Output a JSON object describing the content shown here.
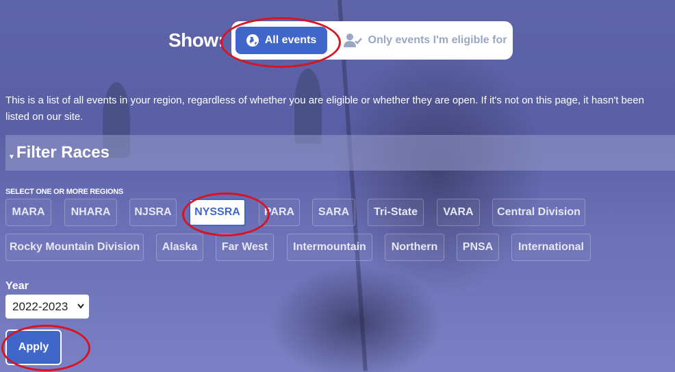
{
  "show": {
    "label": "Show:",
    "options": [
      {
        "label": "All events",
        "icon": "globe-icon",
        "active": true
      },
      {
        "label": "Only events I'm eligible for",
        "icon": "user-check-icon",
        "active": false
      }
    ]
  },
  "description": "This is a list of all events in your region, regardless of whether you are eligible or whether they are open. If it's not on this page, it hasn't been listed on our site.",
  "filter": {
    "title": "Filter Races",
    "regions_label": "SELECT ONE OR MORE REGIONS",
    "regions": [
      {
        "label": "MARA",
        "selected": false
      },
      {
        "label": "NHARA",
        "selected": false
      },
      {
        "label": "NJSRA",
        "selected": false
      },
      {
        "label": "NYSSRA",
        "selected": true
      },
      {
        "label": "PARA",
        "selected": false
      },
      {
        "label": "SARA",
        "selected": false
      },
      {
        "label": "Tri-State",
        "selected": false
      },
      {
        "label": "VARA",
        "selected": false
      },
      {
        "label": "Central Division",
        "selected": false
      },
      {
        "label": "Rocky Mountain Division",
        "selected": false
      },
      {
        "label": "Alaska",
        "selected": false
      },
      {
        "label": "Far West",
        "selected": false
      },
      {
        "label": "Intermountain",
        "selected": false
      },
      {
        "label": "Northern",
        "selected": false
      },
      {
        "label": "PNSA",
        "selected": false
      },
      {
        "label": "International",
        "selected": false
      }
    ],
    "year_label": "Year",
    "year_value": "2022-2023",
    "apply_label": "Apply"
  },
  "colors": {
    "accent": "#3f66c8",
    "annotation": "#d7141f"
  }
}
